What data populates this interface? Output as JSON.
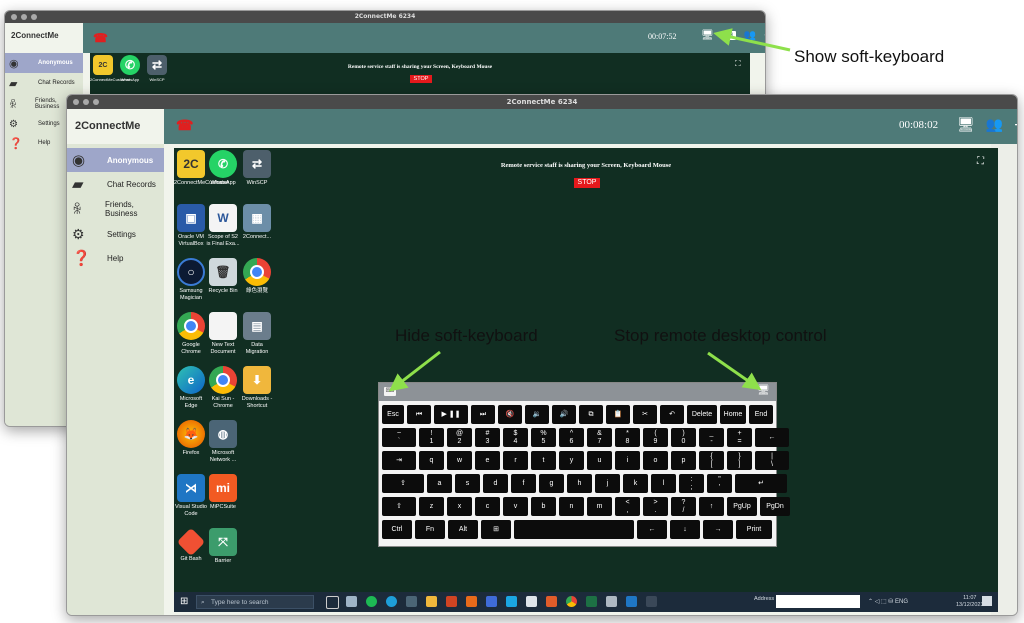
{
  "back_window": {
    "title": "2ConnectMe 6234",
    "brand": "2ConnectMe",
    "timer": "00:07:52",
    "sidebar": [
      {
        "label": "Anonymous",
        "icon": "avatar-icon",
        "active": true
      },
      {
        "label": "Chat Records",
        "icon": "folder-icon"
      },
      {
        "label": "Friends, Business",
        "icon": "people-icon"
      },
      {
        "label": "Settings",
        "icon": "gear-icon"
      },
      {
        "label": "Help",
        "icon": "help-icon"
      }
    ],
    "share_text": "Remote service staff is sharing your Screen, Keyboard Mouse",
    "stop_label": "STOP",
    "desktop_icons": [
      "2ConnectMeCustomer",
      "WhatsApp",
      "WinSCP"
    ]
  },
  "front_window": {
    "title": "2ConnectMe 6234",
    "brand": "2ConnectMe",
    "timer": "00:08:02",
    "sidebar": [
      {
        "label": "Anonymous",
        "icon": "avatar-icon",
        "active": true
      },
      {
        "label": "Chat Records",
        "icon": "folder-icon"
      },
      {
        "label": "Friends, Business",
        "icon": "people-icon"
      },
      {
        "label": "Settings",
        "icon": "gear-icon"
      },
      {
        "label": "Help",
        "icon": "help-icon"
      }
    ],
    "share_text": "Remote service staff is sharing your Screen, Keyboard Mouse",
    "stop_label": "STOP",
    "desktop_icons": [
      [
        "2ConnectMeCustomer",
        "WhatsApp",
        "WinSCP"
      ],
      [
        "Oracle VM VirtualBox",
        "Scope of S2 is Final Exa...",
        "2Connect..."
      ],
      [
        "Samsung Magician",
        "Recycle Bin",
        "綠色瀏覽"
      ],
      [
        "Google Chrome",
        "New Text Document",
        "Data Migration"
      ],
      [
        "Microsoft Edge",
        "Kai Sun - Chrome",
        "Downloads - Shortcut"
      ],
      [
        "Firefox",
        "Microsoft Network ..."
      ],
      [
        "Visual Studio Code",
        "MiPCSuite"
      ],
      [
        "Git Bash",
        "Barrier"
      ]
    ],
    "keyboard": {
      "rows": [
        [
          "Esc",
          "⏮",
          "▶ ❚❚",
          "⏭",
          "🔇",
          "🔉",
          "🔊",
          "⧉",
          "📋",
          "✂",
          "↶",
          "Delete",
          "Home",
          "End"
        ],
        [
          "~\n`",
          "!\n1",
          "@\n2",
          "#\n3",
          "$\n4",
          "%\n5",
          "^\n6",
          "&\n7",
          "*\n8",
          "(\n9",
          ")\n0",
          "_\n-",
          "+\n=",
          "←"
        ],
        [
          "⇥",
          "q",
          "w",
          "e",
          "r",
          "t",
          "y",
          "u",
          "i",
          "o",
          "p",
          "{\n[",
          "}\n]",
          "|\n\\"
        ],
        [
          "⇪",
          "a",
          "s",
          "d",
          "f",
          "g",
          "h",
          "j",
          "k",
          "l",
          ":\n;",
          "\"\n'",
          "↵"
        ],
        [
          "⇧",
          "z",
          "x",
          "c",
          "v",
          "b",
          "n",
          "m",
          "<\n,",
          ">\n.",
          "?\n/",
          "↑",
          "PgUp",
          "PgDn"
        ],
        [
          "Ctrl",
          "Fn",
          "Alt",
          "⊞",
          " ",
          "←",
          "↓",
          "→",
          "Print"
        ]
      ]
    },
    "taskbar": {
      "search_placeholder": "Type here to search",
      "address_label": "Address",
      "lang": "ENG",
      "time": "11:07",
      "date": "13/12/2023"
    }
  },
  "annotations": {
    "show_keyboard": "Show soft-keyboard",
    "hide_keyboard": "Hide soft-keyboard",
    "stop_remote": "Stop remote desktop control"
  },
  "colors": {
    "topbar": "#4e7a78",
    "remote_bg": "#112e22",
    "arrow": "#8ee04b",
    "stop": "#e5191c",
    "sidebar_active": "#9ea6c9"
  }
}
